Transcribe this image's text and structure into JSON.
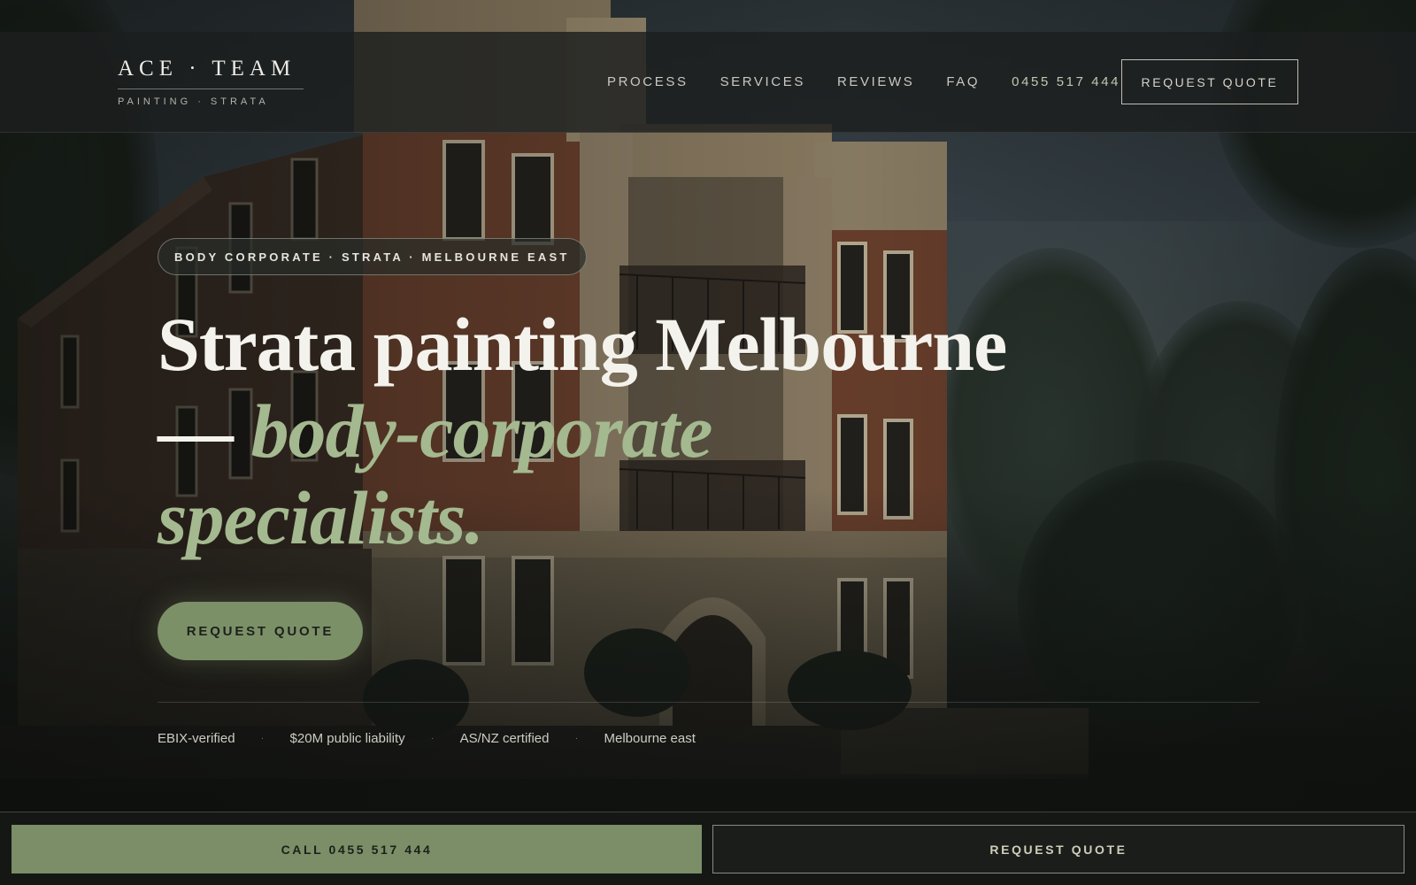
{
  "header": {
    "logo_title": "ACE · TEAM",
    "logo_subtitle": "PAINTING · STRATA",
    "nav": [
      "PROCESS",
      "SERVICES",
      "REVIEWS",
      "FAQ"
    ],
    "phone": "0455 517 444",
    "cta_label": "REQUEST QUOTE"
  },
  "hero": {
    "pill": "BODY CORPORATE · STRATA · MELBOURNE EAST",
    "headline_line1": "Strata painting Melbourne",
    "headline_dash": "— ",
    "headline_accent1": "body-corporate",
    "headline_accent2": "specialists.",
    "cta_label": "REQUEST QUOTE",
    "badges": [
      "EBIX-verified",
      "$20M public liability",
      "AS/NZ certified",
      "Melbourne east"
    ],
    "badge_separator": "·"
  },
  "bottom_bar": {
    "call_label": "CALL 0455 517 444",
    "quote_label": "REQUEST QUOTE"
  },
  "colors": {
    "accent_green": "#7c9068",
    "headline_accent": "#a4b98f",
    "header_bg": "#1c1f1e",
    "page_bg": "#141614"
  }
}
